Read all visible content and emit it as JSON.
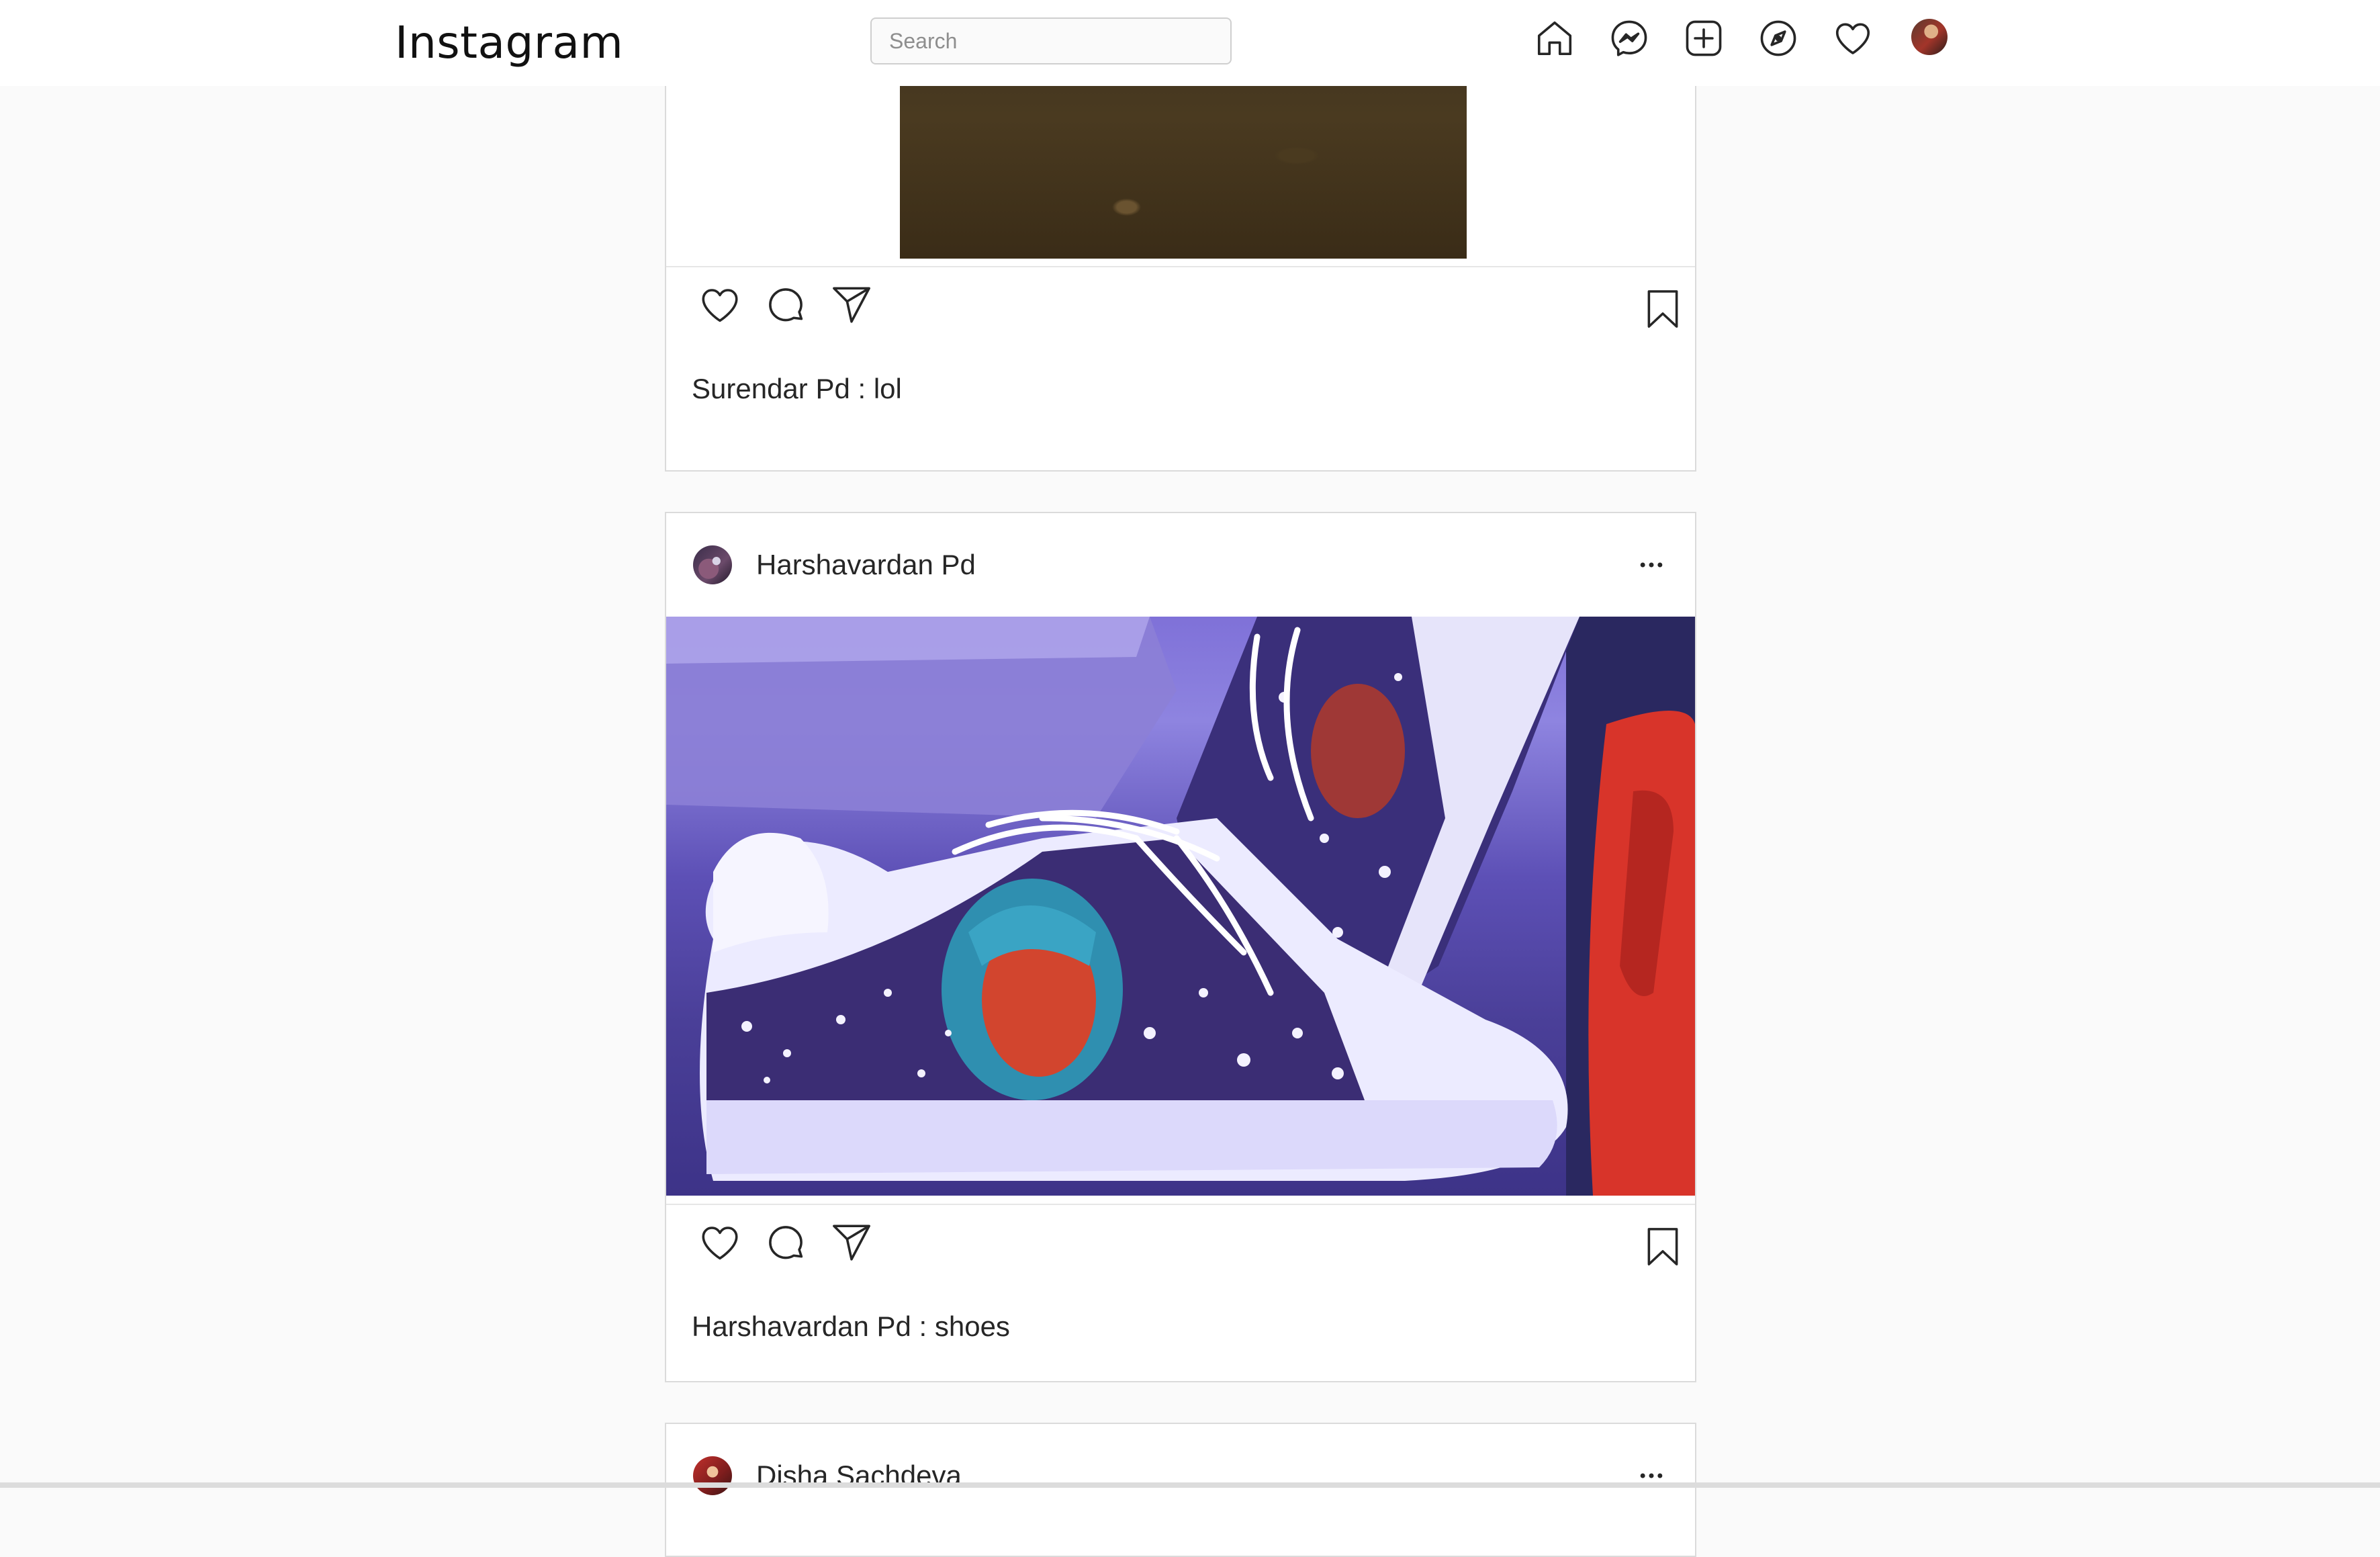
{
  "app": {
    "logo": "Instagram"
  },
  "search": {
    "placeholder": "Search"
  },
  "nav": [
    "home-icon",
    "messenger-icon",
    "new-post-icon",
    "explore-icon",
    "activity-heart-icon",
    "profile-avatar"
  ],
  "posts": [
    {
      "username": "",
      "caption": "Surendar Pd : lol"
    },
    {
      "username": "Harshavardan Pd",
      "caption": "Harshavardan Pd : shoes"
    },
    {
      "username": "Disha Sachdeva",
      "caption": ""
    }
  ],
  "actions": [
    "like-icon",
    "comment-icon",
    "share-icon",
    "save-icon"
  ],
  "colors": {
    "background": "#fafafa",
    "card": "#ffffff",
    "border": "#dbdbdb",
    "text": "#262626"
  }
}
